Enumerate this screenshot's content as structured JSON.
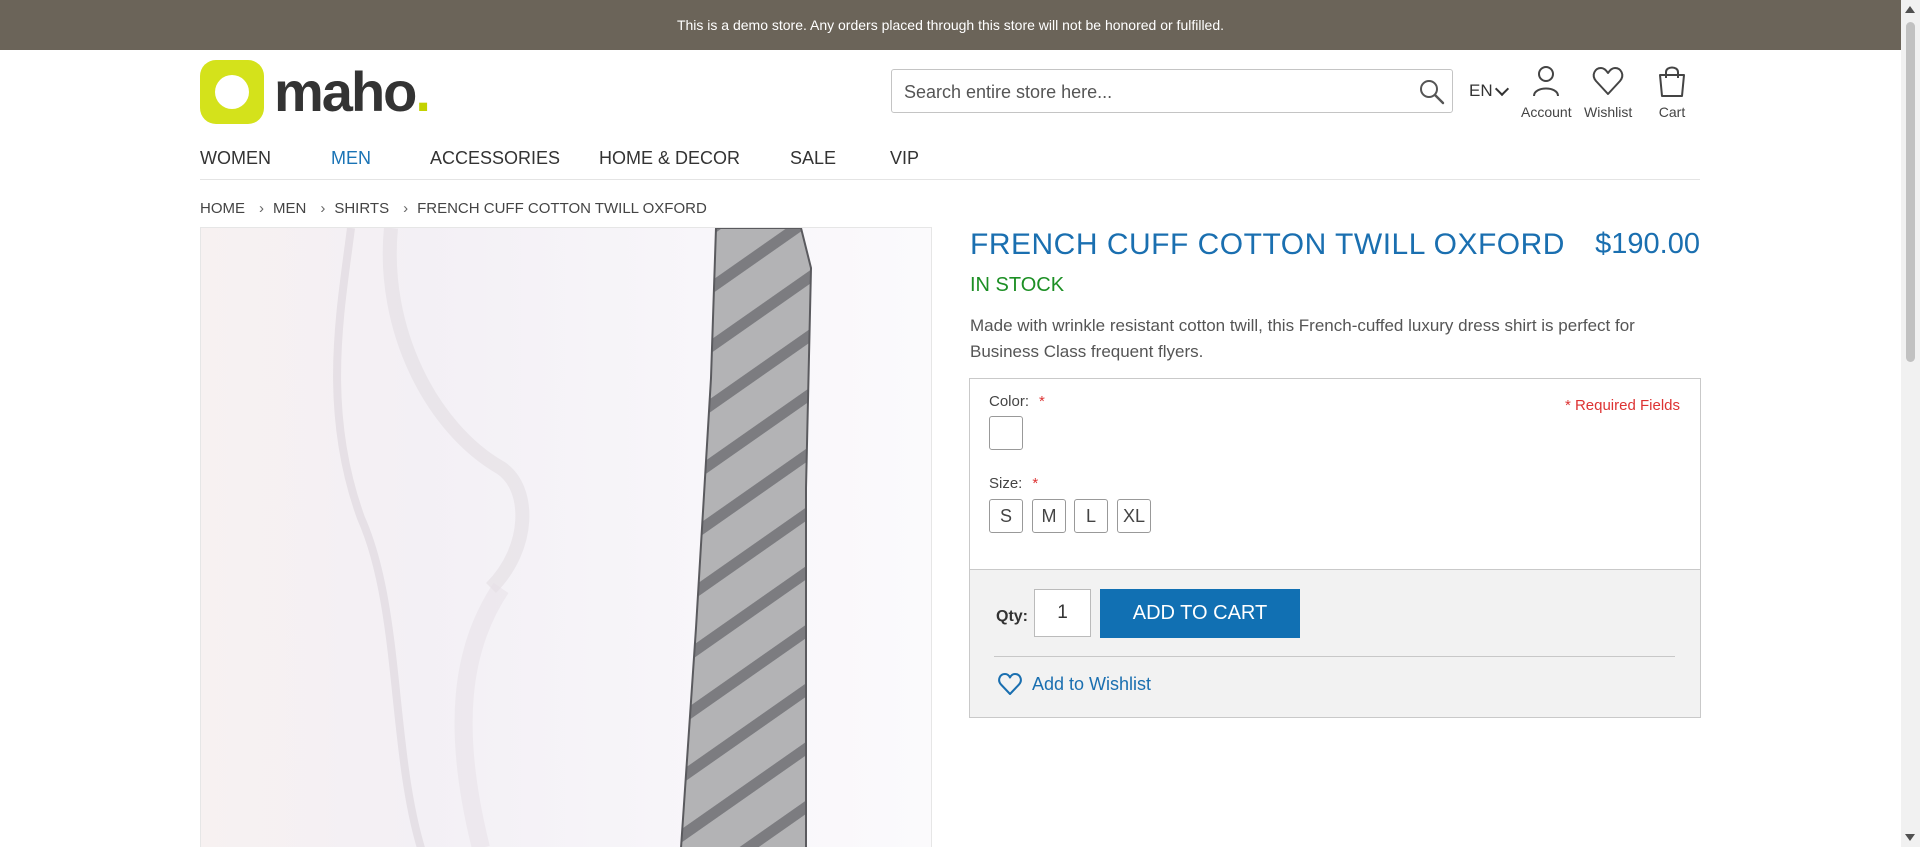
{
  "notice": "This is a demo store. Any orders placed through this store will not be honored or fulfilled.",
  "logo": {
    "text": "maho",
    "dot": "."
  },
  "search": {
    "placeholder": "Search entire store here..."
  },
  "language": "EN",
  "header_links": {
    "account": "Account",
    "wishlist": "Wishlist",
    "cart": "Cart"
  },
  "nav": [
    "WOMEN",
    "MEN",
    "ACCESSORIES",
    "HOME & DECOR",
    "SALE",
    "VIP"
  ],
  "breadcrumb": [
    "HOME",
    "MEN",
    "SHIRTS",
    "FRENCH CUFF COTTON TWILL OXFORD"
  ],
  "breadcrumb_separator": "›",
  "product": {
    "title": "FRENCH CUFF COTTON TWILL OXFORD",
    "price": "$190.00",
    "stock": "IN STOCK",
    "description": "Made with wrinkle resistant cotton twill, this French-cuffed luxury dress shirt is perfect for Business Class frequent flyers."
  },
  "options": {
    "color_label": "Color:",
    "size_label": "Size:",
    "required_star": "*",
    "required_fields": "* Required Fields",
    "sizes": [
      "S",
      "M",
      "L",
      "XL"
    ]
  },
  "cart": {
    "qty_label": "Qty:",
    "qty_value": "1",
    "add_button": "ADD TO CART",
    "wishlist_link": "Add to Wishlist"
  },
  "colors": {
    "brand_blue": "#1170b3",
    "stock_green": "#1c8f24",
    "required_red": "#dd3333",
    "notice_bg": "#6b6459",
    "logo_lime": "#d4e21b"
  }
}
